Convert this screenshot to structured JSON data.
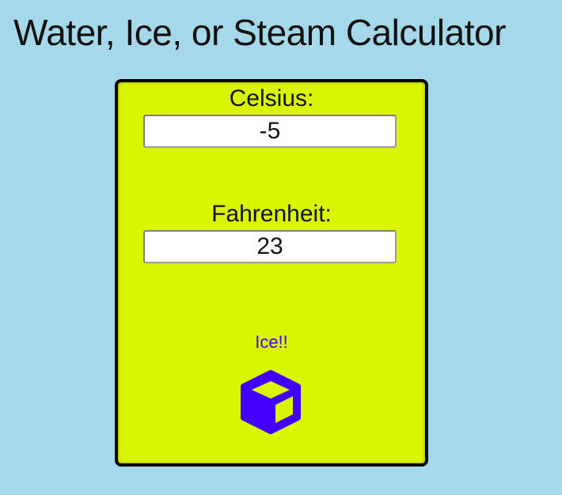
{
  "page": {
    "title": "Water, Ice, or Steam Calculator"
  },
  "converter": {
    "celsius_label": "Celsius:",
    "celsius_value": "-5",
    "fahrenheit_label": "Fahrenheit:",
    "fahrenheit_value": "23"
  },
  "result": {
    "status": "Ice!!",
    "icon": "cube-icon"
  },
  "colors": {
    "background": "#a5d8e8",
    "panel": "#daf500",
    "panel_border": "#000000",
    "accent": "#4200ff"
  }
}
